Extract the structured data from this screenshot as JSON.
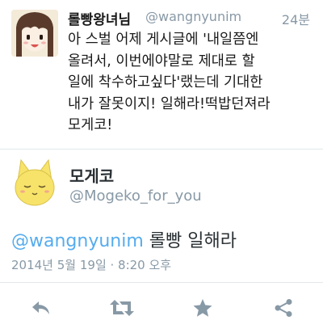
{
  "tweet": {
    "display_name": "롤빵왕녀님",
    "handle": "@wangnyunim",
    "time": "24분",
    "lines": [
      "아 스벌 어제 게시글에 '내일쯤엔",
      "올려서, 이번에야말로 제대로 할",
      "일에 착수하고싶다'랬는데 기대한",
      "내가 잘못이지! 일해라!떡밥던져라",
      "모게코!"
    ]
  },
  "reply": {
    "display_name": "모게코",
    "handle": "@Mogeko_for_you",
    "mention": "@wangnyunim",
    "text": " 롤빵 일해라",
    "timestamp": "2014년 5월 19일 · 8:20 오후"
  },
  "actions": {
    "icons": [
      "reply-icon",
      "retweet-icon",
      "favorite-icon",
      "share-icon"
    ],
    "icon_color": "#8899a6"
  },
  "colors": {
    "link": "#55acee",
    "muted": "#8899a6",
    "divider": "#e1e8ed"
  }
}
